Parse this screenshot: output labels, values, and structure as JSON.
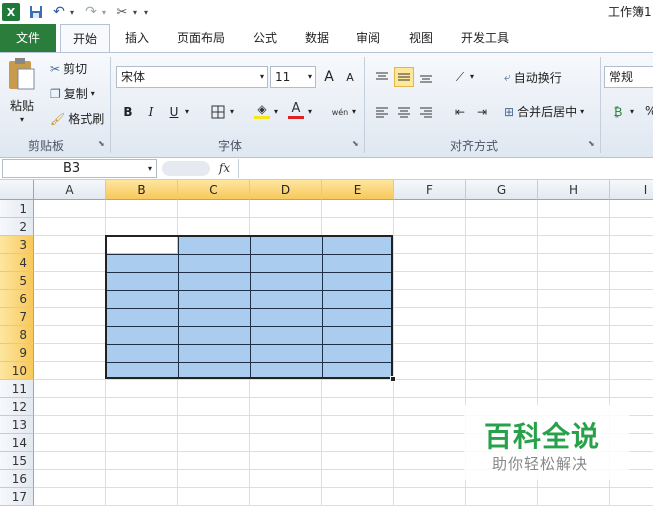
{
  "qat": {
    "title": "工作簿1"
  },
  "tabs": [
    "文件",
    "开始",
    "插入",
    "页面布局",
    "公式",
    "数据",
    "审阅",
    "视图",
    "开发工具"
  ],
  "clipboard": {
    "paste": "粘贴",
    "cut": "剪切",
    "copy": "复制",
    "painter": "格式刷",
    "group": "剪贴板"
  },
  "font": {
    "name": "宋体",
    "size": "11",
    "group": "字体",
    "bold": "B",
    "italic": "I",
    "underline": "U",
    "grow": "A",
    "shrink": "A",
    "phonetic": "wén"
  },
  "align": {
    "wrap": "自动换行",
    "merge": "合并后居中",
    "group": "对齐方式"
  },
  "number": {
    "format": "常规"
  },
  "formula": {
    "namebox": "B3",
    "fx": "fx"
  },
  "grid": {
    "columns": [
      "A",
      "B",
      "C",
      "D",
      "E",
      "F",
      "G",
      "H",
      "I"
    ],
    "rows": [
      "1",
      "2",
      "3",
      "4",
      "5",
      "6",
      "7",
      "8",
      "9",
      "10",
      "11",
      "12",
      "13",
      "14",
      "15",
      "16",
      "17"
    ],
    "selected_columns": [
      "B",
      "C",
      "D",
      "E"
    ],
    "selected_rows": [
      "3",
      "4",
      "5",
      "6",
      "7",
      "8",
      "9",
      "10"
    ],
    "active_cell": "B3",
    "selection": "B3:E10",
    "selection_fill": "#a9ccef"
  },
  "watermark": {
    "title": "百科全说",
    "subtitle": "助你轻松解决"
  }
}
